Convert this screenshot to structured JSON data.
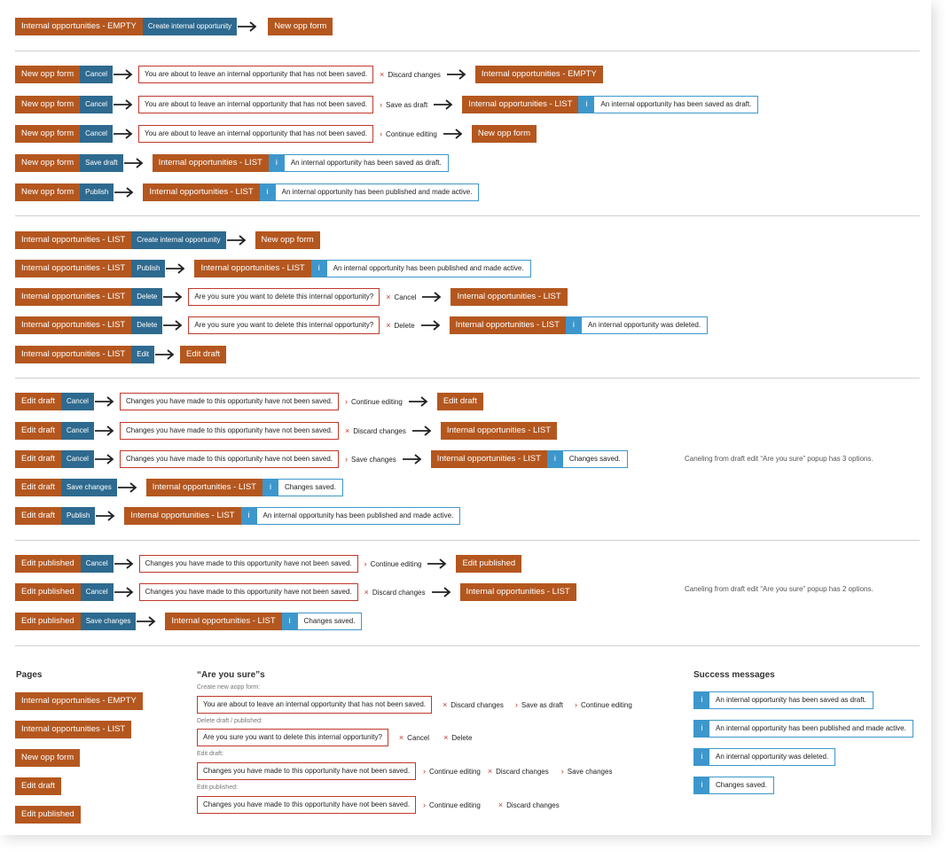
{
  "colors": {
    "page": "#b4571f",
    "action": "#2e6a8f",
    "dialog_border": "#c0392b",
    "info": "#3d97cc"
  },
  "icons": {
    "arrow": "right-arrow-icon",
    "x": "×",
    "chevron": "›",
    "info": "i"
  },
  "flows": {
    "s1": [
      {
        "from": "Internal opportunities - EMPTY",
        "action": "Create internal opportunity",
        "to": "New opp form"
      }
    ],
    "s2": [
      {
        "from": "New opp form",
        "action": "Cancel",
        "dialog": "You are about to leave an internal opportunity that has not been saved.",
        "option_icon": "×",
        "option": "Discard changes",
        "to": "Internal opportunities - EMPTY"
      },
      {
        "from": "New opp form",
        "action": "Cancel",
        "dialog": "You are about to leave an internal opportunity that has not been saved.",
        "option_icon": "›",
        "option": "Save as draft",
        "to": "Internal opportunities - LIST",
        "message": "An internal opportunity has been saved as draft."
      },
      {
        "from": "New opp form",
        "action": "Cancel",
        "dialog": "You are about to leave an internal opportunity that has not been saved.",
        "option_icon": "›",
        "option": "Continue editing",
        "to": "New opp form"
      },
      {
        "from": "New opp form",
        "action": "Save draft",
        "to": "Internal opportunities - LIST",
        "message": "An internal opportunity has been saved as draft."
      },
      {
        "from": "New opp form",
        "action": "Publish",
        "to": "Internal opportunities - LIST",
        "message": "An internal opportunity has been published and made active."
      }
    ],
    "s3": [
      {
        "from": "Internal opportunities - LIST",
        "action": "Create internal opportunity",
        "to": "New opp form"
      },
      {
        "from": "Internal opportunities - LIST",
        "action": "Publish",
        "to": "Internal opportunities - LIST",
        "message": "An internal opportunity has been published and made active."
      },
      {
        "from": "Internal opportunities - LIST",
        "action": "Delete",
        "dialog": "Are you sure you want to delete this internal opportunity?",
        "option_icon": "×",
        "option": "Cancel",
        "to": "Internal opportunities - LIST"
      },
      {
        "from": "Internal opportunities - LIST",
        "action": "Delete",
        "dialog": "Are you sure you want to delete this internal opportunity?",
        "option_icon": "×",
        "option": "Delete",
        "to": "Internal opportunities - LIST",
        "message": "An internal opportunity was deleted."
      },
      {
        "from": "Internal opportunities - LIST",
        "action": "Edit",
        "to": "Edit draft"
      }
    ],
    "s4": [
      {
        "from": "Edit draft",
        "action": "Cancel",
        "dialog": "Changes you have made to this opportunity have not been saved.",
        "option_icon": "›",
        "option": "Continue editing",
        "to": "Edit draft"
      },
      {
        "from": "Edit draft",
        "action": "Cancel",
        "dialog": "Changes you have made to this opportunity have not been saved.",
        "option_icon": "×",
        "option": "Discard changes",
        "to": "Internal opportunities - LIST"
      },
      {
        "from": "Edit draft",
        "action": "Cancel",
        "dialog": "Changes you have made to this opportunity have not been saved.",
        "option_icon": "›",
        "option": "Save changes",
        "to": "Internal opportunities - LIST",
        "message": "Changes saved."
      },
      {
        "from": "Edit draft",
        "action": "Save changes",
        "to": "Internal opportunities - LIST",
        "message": "Changes saved."
      },
      {
        "from": "Edit draft",
        "action": "Publish",
        "to": "Internal opportunities - LIST",
        "message": "An internal opportunity has been published and made active."
      }
    ],
    "s4_note": "Caneling from draft edit “Are you sure” popup has 3 options.",
    "s5": [
      {
        "from": "Edit published",
        "action": "Cancel",
        "dialog": "Changes you have made to this opportunity have not been saved.",
        "option_icon": "›",
        "option": "Continue editing",
        "to": "Edit published"
      },
      {
        "from": "Edit published",
        "action": "Cancel",
        "dialog": "Changes you have made to this opportunity have not been saved.",
        "option_icon": "×",
        "option": "Discard changes",
        "to": "Internal opportunities - LIST"
      },
      {
        "from": "Edit published",
        "action": "Save changes",
        "to": "Internal opportunities - LIST",
        "message": "Changes saved."
      }
    ],
    "s5_note": "Caneling from draft edit “Are you sure” popup has 2 options."
  },
  "legend": {
    "pages": {
      "title": "Pages",
      "items": [
        "Internal opportunities - EMPTY",
        "Internal opportunities - LIST",
        "New opp form",
        "Edit draft",
        "Edit published"
      ]
    },
    "are_you_sure": {
      "title": "“Are you sure”s",
      "groups": [
        {
          "label": "Create new aopp form:",
          "dialog": "You are about to leave an internal opportunity that has not been saved.",
          "options": [
            {
              "icon": "×",
              "text": "Discard changes"
            },
            {
              "icon": "›",
              "text": "Save as draft"
            },
            {
              "icon": "›",
              "text": "Continue editing"
            }
          ]
        },
        {
          "label": "Delete draft / published:",
          "dialog": "Are you sure you want to delete this internal opportunity?",
          "options": [
            {
              "icon": "×",
              "text": "Cancel"
            },
            {
              "icon": "×",
              "text": "Delete"
            }
          ]
        },
        {
          "label": "Edit draft:",
          "dialog": "Changes you have made to this opportunity have not been saved.",
          "options": [
            {
              "icon": "›",
              "text": "Continue editing"
            },
            {
              "icon": "×",
              "text": "Discard changes"
            },
            {
              "icon": "›",
              "text": "Save changes"
            }
          ]
        },
        {
          "label": "Edit published:",
          "dialog": "Changes you have made to this opportunity have not been saved.",
          "options": [
            {
              "icon": "›",
              "text": "Continue editing"
            },
            {
              "icon": "×",
              "text": "Discard changes"
            }
          ]
        }
      ]
    },
    "success": {
      "title": "Success messages",
      "items": [
        "An internal opportunity has been saved as draft.",
        "An internal opportunity has been published and made active.",
        "An internal opportunity was deleted.",
        "Changes saved."
      ]
    }
  }
}
